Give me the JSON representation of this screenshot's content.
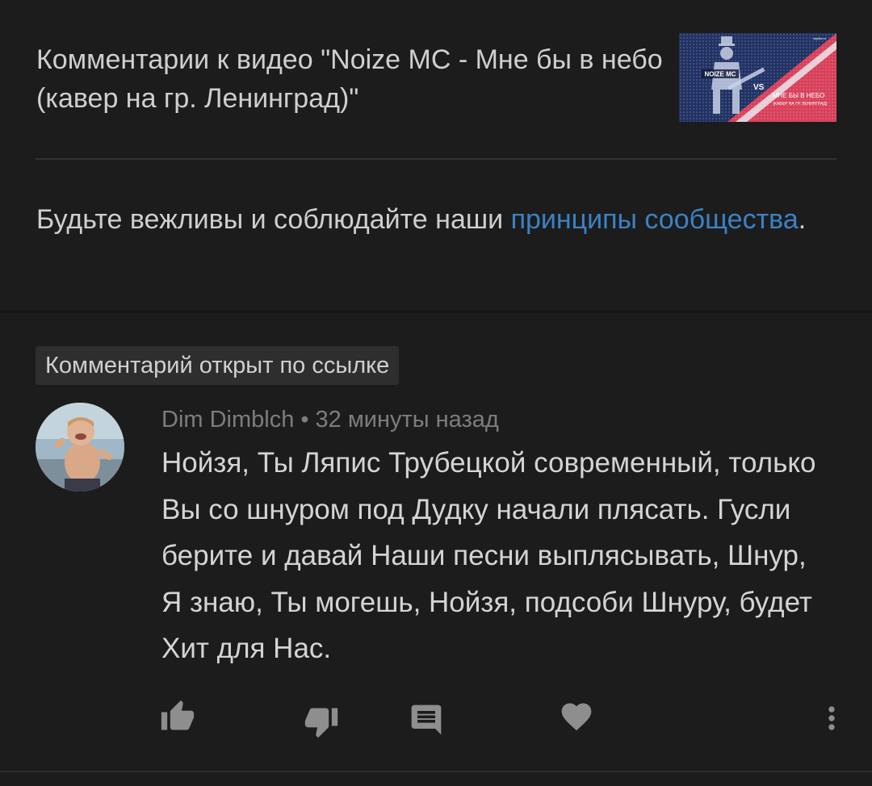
{
  "header": {
    "title": "Комментарии к видео \"Noize MC - Мне бы в небо (кавер на гр. Ленинград)\"",
    "thumbnail": {
      "caption_line1": "МНЕ БЫ В НЕБО",
      "caption_line2": "(КАВЕР НА ГР. ЛЕНИНГРАД)",
      "logo_text": "NOIZE MC",
      "corner_text": "ssylka.ru"
    }
  },
  "guidelines": {
    "text_before": "Будьте вежливы и соблюдайте наши ",
    "link_text": "принципы сообщества",
    "text_after": "."
  },
  "comment": {
    "badge": "Комментарий открыт по ссылке",
    "author": "Dim Dimblch",
    "separator": "•",
    "time": "32 минуты назад",
    "text": "Нойзя, Ты  Ляпис Трубецкой современный, только Вы со шнуром под Дудку начали плясать. Гусли берите и давай Наши песни выплясывать, Шнур, Я знаю, Ты могешь, Нойзя, подсоби Шнуру, будет Хит для Нас."
  },
  "actions": {
    "like_icon": "thumb-up-icon",
    "dislike_icon": "thumb-down-icon",
    "reply_icon": "reply-icon",
    "heart_icon": "heart-icon",
    "more_icon": "more-vert-icon"
  },
  "colors": {
    "background": "#1c1c1c",
    "text": "#cfcfcf",
    "link": "#3b82c4",
    "meta": "#7d7d7d",
    "icon": "#8e8e8e"
  }
}
